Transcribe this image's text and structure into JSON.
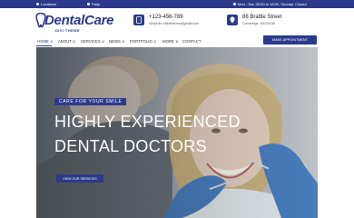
{
  "topbar": {
    "locations": "Locations",
    "faqs": "Faqs",
    "hours": "Mon - Sat: 09:00 to 18:00, Sunday: Closed"
  },
  "logo": {
    "name": "DentalCare",
    "tagline": "DIVI THEME"
  },
  "contact": {
    "phone": "+123-456-789",
    "email": "info@divi childthemes@gmail.com",
    "street": "86 Brattle Street",
    "city": "Cambridge, MA 02138"
  },
  "nav": {
    "items": [
      {
        "label": "HOME ∨"
      },
      {
        "label": "ABOUT ∨"
      },
      {
        "label": "SERVICES ∨"
      },
      {
        "label": "NEWS ∨"
      },
      {
        "label": "PORTFOLIO ∨"
      },
      {
        "label": "MORE ∨"
      },
      {
        "label": "CONTACT"
      }
    ],
    "cta": "MAKE APPOINTMENT"
  },
  "hero": {
    "tag": "CARE FOR YOUR SMILE",
    "title_line1": "HIGHLY EXPERIENCED",
    "title_line2": "DENTAL DOCTORS",
    "button": "VIEW OUR SERVICES"
  },
  "colors": {
    "brand": "#2c3a8c",
    "white": "#ffffff"
  }
}
